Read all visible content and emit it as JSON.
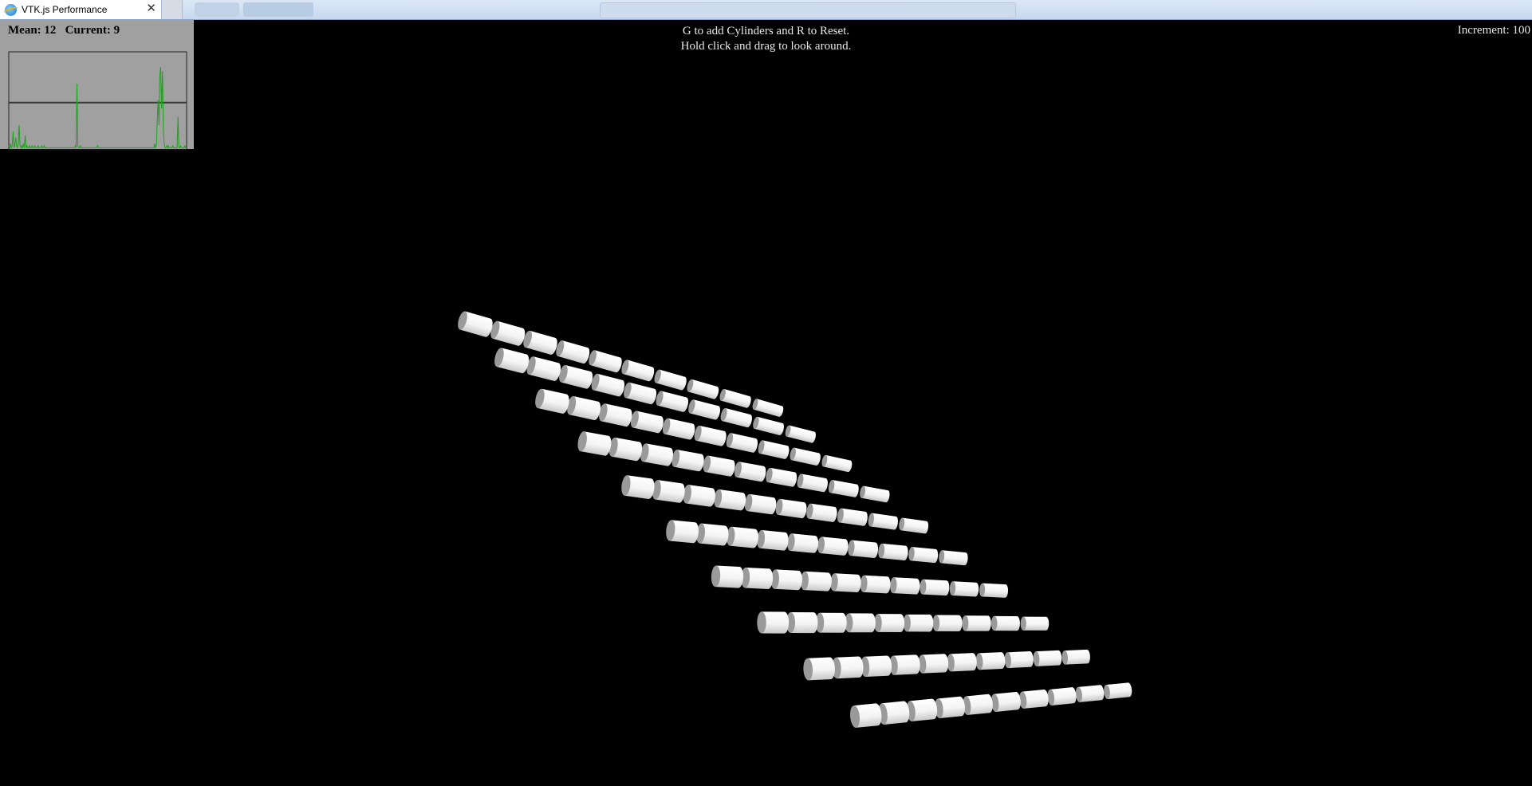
{
  "browser": {
    "tab_title": "VTK.js Performance",
    "tab_close": "✕",
    "tab_icon": "ie-globe-icon"
  },
  "overlay": {
    "fps_mean_label": "Mean: 12",
    "fps_current_label": "Current: 9",
    "instruction_line_1": "G to add Cylinders and R to Reset.",
    "instruction_line_2": "Hold click and drag to look around.",
    "increment_label": "Increment: 100"
  },
  "fps_history": {
    "mean_value": 12,
    "current_value": 9,
    "samples": [
      2,
      1,
      3,
      1,
      2,
      9,
      1,
      2,
      6,
      2,
      1,
      3,
      12,
      2,
      1,
      2,
      1,
      3,
      1,
      7,
      1,
      2,
      1,
      1,
      2,
      1,
      1,
      2,
      1,
      1,
      2,
      1,
      1,
      1,
      2,
      1,
      1,
      1,
      2,
      1,
      1,
      2,
      1,
      1,
      1,
      1,
      1,
      1,
      1,
      1,
      1,
      1,
      1,
      1,
      1,
      1,
      1,
      1,
      1,
      1,
      1,
      1,
      1,
      1,
      1,
      1,
      1,
      1,
      1,
      1,
      1,
      1,
      1,
      1,
      1,
      1,
      1,
      2,
      1,
      32,
      2,
      1,
      1,
      2,
      1,
      1,
      1,
      1,
      1,
      1,
      1,
      1,
      1,
      1,
      1,
      1,
      1,
      1,
      1,
      1,
      1,
      1,
      1,
      2,
      1,
      1,
      1,
      1,
      1,
      1,
      1,
      1,
      1,
      1,
      1,
      1,
      1,
      1,
      1,
      1,
      1,
      1,
      1,
      1,
      1,
      1,
      1,
      1,
      1,
      1,
      1,
      1,
      1,
      1,
      1,
      1,
      1,
      1,
      1,
      1,
      1,
      1,
      1,
      1,
      1,
      1,
      1,
      1,
      1,
      1,
      1,
      1,
      1,
      1,
      1,
      1,
      1,
      1,
      1,
      1,
      1,
      1,
      1,
      1,
      1,
      1,
      1,
      1,
      1,
      3,
      1,
      2,
      14,
      24,
      12,
      36,
      40,
      20,
      38,
      10,
      3,
      1,
      1,
      2,
      1,
      2,
      1,
      1,
      1,
      1,
      2,
      1,
      1,
      1,
      1,
      1,
      16,
      1,
      1,
      2,
      1,
      1,
      1,
      1,
      2,
      1,
      1
    ],
    "colors": {
      "background": "#a0a0a0",
      "line": "#1fa01f",
      "mean_line": "#3a3a3a",
      "border": "#222222"
    }
  },
  "scene": {
    "grid_rows": 10,
    "grid_cols": 10,
    "cylinder_color": "#ffffff",
    "cap_color": "#9a9a9a",
    "background": "#000000"
  }
}
